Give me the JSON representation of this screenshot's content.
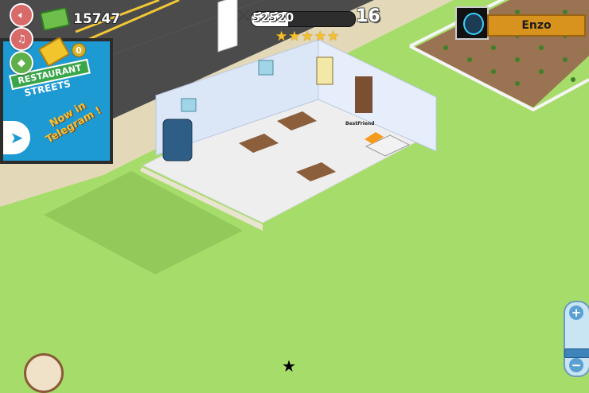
{
  "hud": {
    "cash_amount": "15747",
    "gold_count": "0",
    "xp_value": "52520",
    "xp_fill_fraction": 0.35,
    "level": "16",
    "stars_rating": 5,
    "player_name": "Enzo"
  },
  "billboard": {
    "line1": "RESTAURANT",
    "line2": "STREETS",
    "line3": "Now in Telegram !"
  },
  "scene": {
    "npc_tag": "BestFriend"
  },
  "zoom": {
    "plus_label": "+",
    "minus_label": "−"
  },
  "icons": [
    "speaker-icon",
    "music-note-icon",
    "diamond-icon",
    "money-icon",
    "gold-bars-icon",
    "fork-knife-icon",
    "star-icon",
    "telegram-icon",
    "compass-icon"
  ],
  "colors": {
    "grass": "#a6dc6a",
    "road": "#4a4a4a",
    "wall": "#dbe6f7",
    "floor": "#f1f1f1",
    "accent": "#d8931e"
  }
}
